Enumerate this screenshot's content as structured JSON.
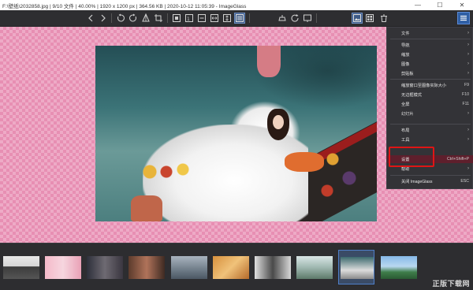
{
  "window": {
    "title": "F:\\壁纸\\2032858.jpg  |  9/10 文件  |  40.00%  |  1920 x 1200 px  |  364.56 KB  |  2020-10-12 11:05:39  -  ImageGlass",
    "minimize_glyph": "—",
    "maximize_glyph": "☐",
    "close_glyph": "✕"
  },
  "toolbar": {
    "icons": [
      "chevron-left-icon",
      "chevron-right-icon",
      "rotate-left-icon",
      "rotate-right-icon",
      "flip-icon",
      "crop-icon",
      "zoom-fit-icon",
      "actual-size-icon",
      "lock-zoom-icon",
      "scale-width-icon",
      "scale-height-icon",
      "window-fit-icon",
      "checkerboard-icon",
      "refresh-icon",
      "slideshow-icon",
      "gallery-icon",
      "thumbnail-icon",
      "delete-icon",
      "menu-icon"
    ]
  },
  "menu": {
    "items": [
      {
        "label": "文件",
        "shortcut": "",
        "submenu": true
      },
      {
        "label": "导航",
        "shortcut": "",
        "submenu": true
      },
      {
        "label": "缩放",
        "shortcut": "",
        "submenu": true
      },
      {
        "label": "图像",
        "shortcut": "",
        "submenu": true
      },
      {
        "label": "剪贴板",
        "shortcut": "",
        "submenu": true
      },
      {
        "label": "缩放窗口至图像实际大小",
        "shortcut": "F9",
        "submenu": false
      },
      {
        "label": "无边框模式",
        "shortcut": "F10",
        "submenu": false
      },
      {
        "label": "全屏",
        "shortcut": "F11",
        "submenu": false
      },
      {
        "label": "幻灯片",
        "shortcut": "",
        "submenu": true
      },
      {
        "label": "布局",
        "shortcut": "",
        "submenu": true
      },
      {
        "label": "工具",
        "shortcut": "",
        "submenu": true
      },
      {
        "label": "设置",
        "shortcut": "Ctrl+Shift+P",
        "submenu": false
      },
      {
        "label": "帮助",
        "shortcut": "",
        "submenu": true
      },
      {
        "label": "关闭 ImageGlass",
        "shortcut": "ESC",
        "submenu": false
      }
    ],
    "submenu_arrow": "›"
  },
  "thumbnails": {
    "count": 10,
    "selected_index": 8
  },
  "watermark": "正版下载网",
  "colors": {
    "accent": "#2f5fa5",
    "highlight": "#e01515",
    "checker_light": "#eeaac6",
    "checker_dark": "#e78fb3"
  }
}
